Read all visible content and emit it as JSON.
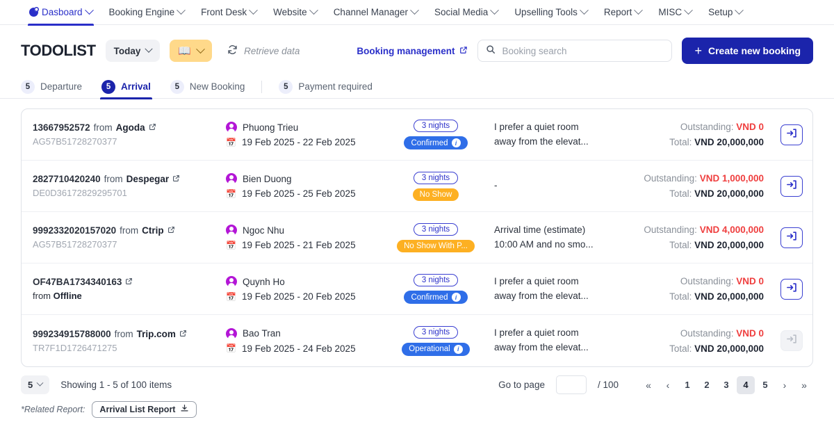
{
  "topnav": {
    "items": [
      {
        "label": "Dasboard",
        "icon": "dashboard-pie-icon",
        "active": true,
        "caret": true
      },
      {
        "label": "Booking Engine",
        "active": false,
        "caret": true
      },
      {
        "label": "Front Desk",
        "active": false,
        "caret": true
      },
      {
        "label": "Website",
        "active": false,
        "caret": true
      },
      {
        "label": "Channel Manager",
        "active": false,
        "caret": true
      },
      {
        "label": "Social Media",
        "active": false,
        "caret": true
      },
      {
        "label": "Upselling Tools",
        "active": false,
        "caret": true
      },
      {
        "label": "Report",
        "active": false,
        "caret": true
      },
      {
        "label": "MISC",
        "active": false,
        "caret": true
      },
      {
        "label": "Setup",
        "active": false,
        "caret": true
      }
    ]
  },
  "header": {
    "brand": "TODOLIST",
    "date_filter": "Today",
    "book_icon": "open-book-icon",
    "retrieve_label": "Retrieve data",
    "refresh_icon": "refresh-icon",
    "booking_management": "Booking management",
    "external_icon": "external-link-icon",
    "search": {
      "placeholder": "Booking search",
      "value": "",
      "icon": "search-icon"
    },
    "create_button": "Create new booking"
  },
  "tabs": [
    {
      "count": "5",
      "label": "Departure",
      "active": false
    },
    {
      "count": "5",
      "label": "Arrival",
      "active": true
    },
    {
      "count": "5",
      "label": "New Booking",
      "active": false
    },
    {
      "count": "5",
      "label": "Payment required",
      "active": false
    }
  ],
  "rows": [
    {
      "ref_number": "13667952572",
      "from_word": "from",
      "source": "Agoda",
      "sub_ref": "AG57B51728270377",
      "sub_style": "muted",
      "guest": "Phuong Trieu",
      "dates": "19 Feb 2025 - 22 Feb 2025",
      "nights": "3 nights",
      "status": "Confirmed",
      "status_color": "blue",
      "status_info": true,
      "note_line1": "I prefer a quiet room",
      "note_line2": "away from the elevat...",
      "outstanding_label": "Outstanding:",
      "outstanding_value": "VND 0",
      "total_label": "Total:",
      "total_value": "VND 20,000,000",
      "action_icon": "check-in-icon",
      "action_disabled": false
    },
    {
      "ref_number": "2827710420240",
      "from_word": "from",
      "source": "Despegar",
      "sub_ref": "DE0D36172829295701",
      "sub_style": "muted",
      "guest": "Bien Duong",
      "dates": "19 Feb 2025 - 25 Feb 2025",
      "nights": "3 nights",
      "status": "No Show",
      "status_color": "amber",
      "status_info": false,
      "note_line1": "-",
      "note_line2": "",
      "outstanding_label": "Outstanding:",
      "outstanding_value": "VND 1,000,000",
      "total_label": "Total:",
      "total_value": "VND 20,000,000",
      "action_icon": "check-in-icon",
      "action_disabled": false
    },
    {
      "ref_number": "9992332020157020",
      "from_word": "from",
      "source": "Ctrip",
      "sub_ref": "AG57B51728270377",
      "sub_style": "muted",
      "guest": "Ngoc Nhu",
      "dates": "19 Feb 2025 - 21 Feb 2025",
      "nights": "3 nights",
      "status": "No Show With P...",
      "status_color": "amber",
      "status_info": false,
      "note_line1": "Arrival time (estimate)",
      "note_line2": "10:00 AM and no smo...",
      "outstanding_label": "Outstanding:",
      "outstanding_value": "VND 4,000,000",
      "total_label": "Total:",
      "total_value": "VND 20,000,000",
      "action_icon": "check-in-icon",
      "action_disabled": false
    },
    {
      "ref_number": "OF47BA1734340163",
      "from_word": "",
      "source": "",
      "sub_ref": "from Offline",
      "sub_style": "dark",
      "sub_prefix": "from ",
      "sub_bold": "Offline",
      "guest": "Quynh Ho",
      "dates": "19 Feb 2025 - 20 Feb 2025",
      "nights": "3 nights",
      "status": "Confirmed",
      "status_color": "blue",
      "status_info": true,
      "note_line1": "I prefer a quiet room",
      "note_line2": "away from the elevat...",
      "outstanding_label": "Outstanding:",
      "outstanding_value": "VND 0",
      "total_label": "Total:",
      "total_value": "VND 20,000,000",
      "action_icon": "check-in-icon",
      "action_disabled": false
    },
    {
      "ref_number": "999234915788000",
      "from_word": "from",
      "source": "Trip.com",
      "sub_ref": "TR7F1D1726471275",
      "sub_style": "muted",
      "guest": "Bao Tran",
      "dates": "19 Feb 2025 - 24 Feb 2025",
      "nights": "3 nights",
      "status": "Operational",
      "status_color": "blue",
      "status_info": true,
      "note_line1": "I prefer a quiet room",
      "note_line2": "away from the elevat...",
      "outstanding_label": "Outstanding:",
      "outstanding_value": "VND 0",
      "total_label": "Total:",
      "total_value": "VND 20,000,000",
      "action_icon": "check-in-icon",
      "action_disabled": true
    }
  ],
  "footer": {
    "page_size": "5",
    "showing": "Showing 1 - 5 of 100 items",
    "goto_label": "Go to page",
    "goto_value": "",
    "goto_total": "/ 100",
    "pages": [
      "1",
      "2",
      "3",
      "4",
      "5"
    ],
    "active_page": "4",
    "first_icon": "«",
    "prev_icon": "‹",
    "next_icon": "›",
    "last_icon": "»"
  },
  "related": {
    "label": "*Related Report:",
    "report_button": "Arrival List Report",
    "download_icon": "download-icon"
  },
  "colors": {
    "brand_blue": "#1b24ab",
    "accent_blue": "#2a2fc9",
    "status_blue": "#2f6ee8",
    "status_amber": "#fdb022",
    "amber_button": "#ffd98a",
    "danger_red": "#ef3e3e",
    "avatar_purple": "#b316d6"
  }
}
